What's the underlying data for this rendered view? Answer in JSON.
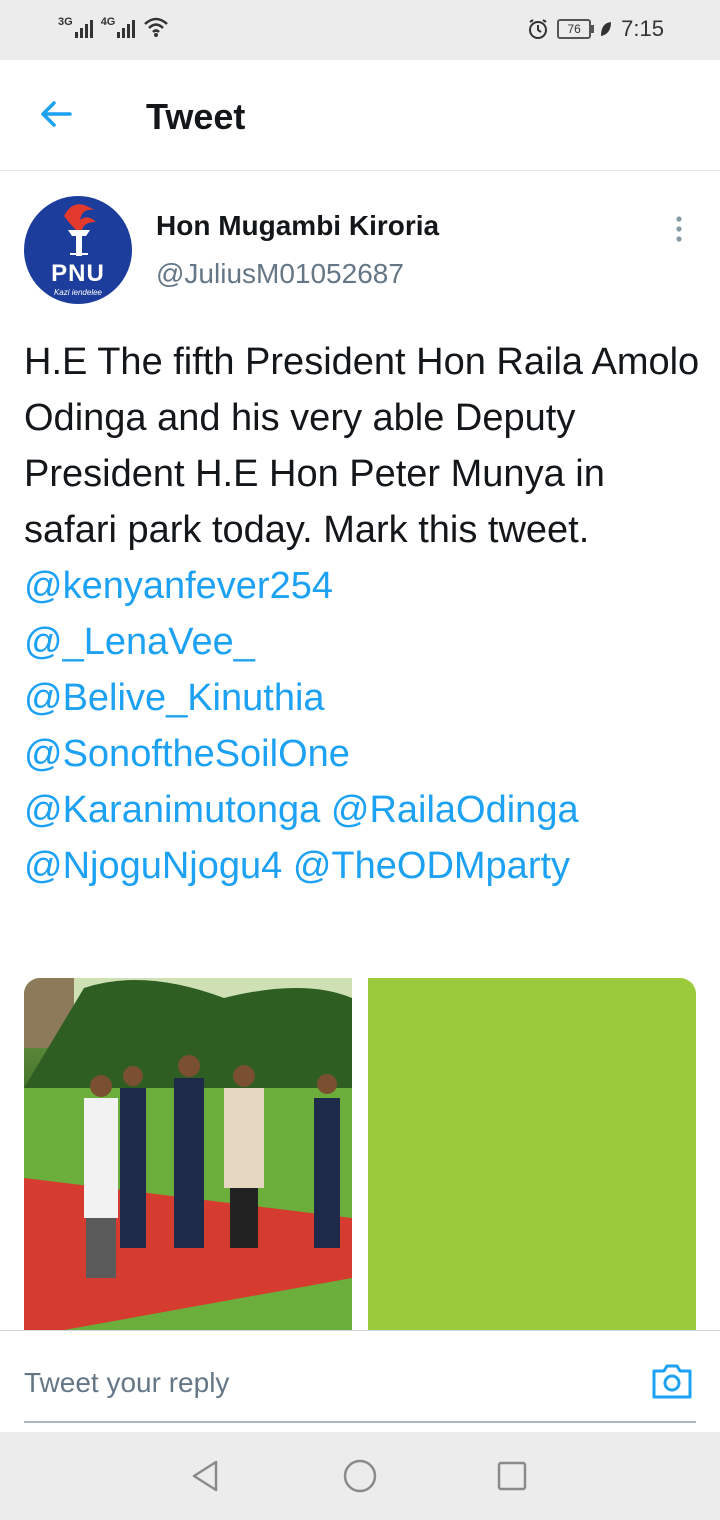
{
  "status_bar": {
    "network1": "3G",
    "network2": "4G",
    "battery": "76",
    "time": "7:15"
  },
  "header": {
    "title": "Tweet"
  },
  "tweet": {
    "display_name": "Hon Mugambi Kiroria",
    "handle": "@JuliusM01052687",
    "avatar": {
      "logo_text": "PNU",
      "tagline": "Kazi iendelee"
    },
    "text": "H.E  The fifth President Hon Raila Amolo Odinga and his very able Deputy President H.E Hon Peter Munya in safari park today. Mark this tweet.",
    "mentions": [
      "@kenyanfever254",
      "@_LenaVee_",
      "@Belive_Kinuthia",
      "@SonoftheSoilOne",
      "@Karanimutonga",
      "@RailaOdinga",
      "@NjoguNjogu4",
      "@TheODMparty"
    ]
  },
  "reply": {
    "placeholder": "Tweet your reply"
  },
  "colors": {
    "accent": "#1da1f2",
    "secondary_text": "#657786",
    "photo_placeholder": "#9bcb3c"
  },
  "icons": [
    "back-arrow-icon",
    "more-vertical-icon",
    "camera-icon",
    "nav-back-icon",
    "nav-home-icon",
    "nav-recents-icon"
  ]
}
